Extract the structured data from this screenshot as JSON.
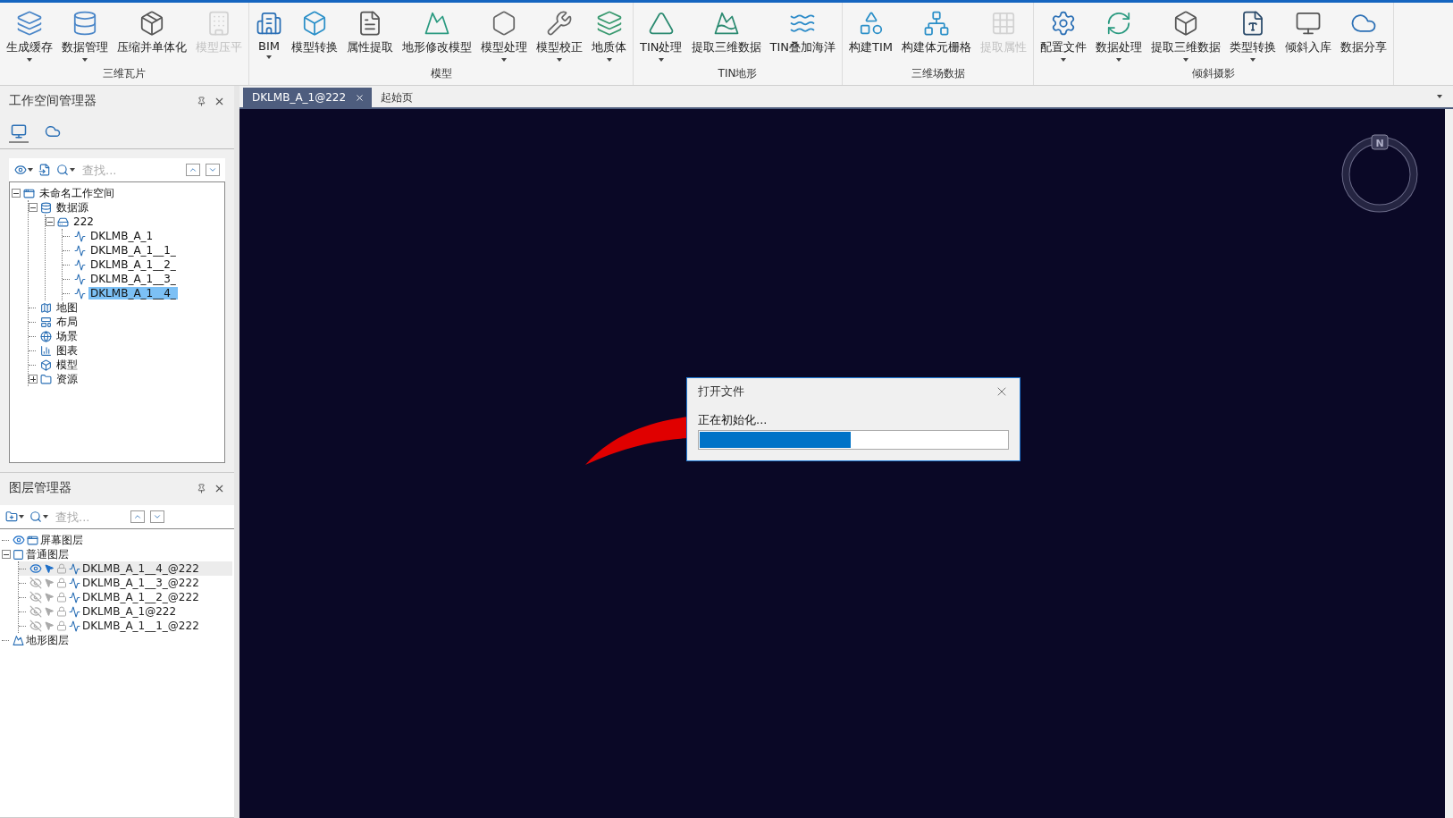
{
  "ribbon": {
    "groups": [
      {
        "label": "三维瓦片",
        "buttons": [
          {
            "label": "生成缓存",
            "menu": true,
            "disabled": false
          },
          {
            "label": "数据管理",
            "menu": true,
            "disabled": false
          },
          {
            "label": "压缩并单体化",
            "menu": false,
            "disabled": false
          },
          {
            "label": "模型压平",
            "menu": false,
            "disabled": true
          }
        ]
      },
      {
        "label": "模型",
        "buttons": [
          {
            "label": "BIM",
            "menu": true,
            "disabled": false
          },
          {
            "label": "模型转换",
            "menu": false,
            "disabled": false
          },
          {
            "label": "属性提取",
            "menu": false,
            "disabled": false
          },
          {
            "label": "地形修改模型",
            "menu": false,
            "disabled": false
          },
          {
            "label": "模型处理",
            "menu": true,
            "disabled": false
          },
          {
            "label": "模型校正",
            "menu": true,
            "disabled": false
          },
          {
            "label": "地质体",
            "menu": true,
            "disabled": false
          }
        ]
      },
      {
        "label": "TIN地形",
        "buttons": [
          {
            "label": "TIN处理",
            "menu": true,
            "disabled": false
          },
          {
            "label": "提取三维数据",
            "menu": false,
            "disabled": false
          },
          {
            "label": "TIN叠加海洋",
            "menu": false,
            "disabled": false
          }
        ]
      },
      {
        "label": "三维场数据",
        "buttons": [
          {
            "label": "构建TIM",
            "menu": false,
            "disabled": false
          },
          {
            "label": "构建体元栅格",
            "menu": false,
            "disabled": false
          },
          {
            "label": "提取属性",
            "menu": false,
            "disabled": true
          }
        ]
      },
      {
        "label": "倾斜摄影",
        "buttons": [
          {
            "label": "配置文件",
            "menu": true,
            "disabled": false
          },
          {
            "label": "数据处理",
            "menu": true,
            "disabled": false
          },
          {
            "label": "提取三维数据",
            "menu": true,
            "disabled": false
          },
          {
            "label": "类型转换",
            "menu": true,
            "disabled": false
          },
          {
            "label": "倾斜入库",
            "menu": false,
            "disabled": false
          },
          {
            "label": "数据分享",
            "menu": false,
            "disabled": false
          }
        ]
      }
    ]
  },
  "workspace_panel": {
    "title": "工作空间管理器",
    "tabs": [
      {
        "selected": true
      },
      {
        "selected": false
      }
    ],
    "search": {
      "placeholder": "查找..."
    },
    "tree": [
      {
        "label": "未命名工作空间",
        "kind": "workspace",
        "expanded": true,
        "selected": false,
        "children": [
          {
            "label": "数据源",
            "kind": "datasources",
            "expanded": true,
            "selected": false,
            "children": [
              {
                "label": "222",
                "kind": "database",
                "expanded": true,
                "selected": false,
                "children": [
                  {
                    "label": "DKLMB_A_1",
                    "kind": "dataset",
                    "selected": false
                  },
                  {
                    "label": "DKLMB_A_1__1_",
                    "kind": "dataset",
                    "selected": false
                  },
                  {
                    "label": "DKLMB_A_1__2_",
                    "kind": "dataset",
                    "selected": false
                  },
                  {
                    "label": "DKLMB_A_1__3_",
                    "kind": "dataset",
                    "selected": false
                  },
                  {
                    "label": "DKLMB_A_1__4_",
                    "kind": "dataset",
                    "selected": true
                  }
                ]
              }
            ]
          },
          {
            "label": "地图",
            "kind": "map",
            "selected": false
          },
          {
            "label": "布局",
            "kind": "layout",
            "selected": false
          },
          {
            "label": "场景",
            "kind": "scene",
            "selected": false
          },
          {
            "label": "图表",
            "kind": "chart",
            "selected": false
          },
          {
            "label": "模型",
            "kind": "model",
            "selected": false
          },
          {
            "label": "资源",
            "kind": "resource",
            "expanded": false,
            "selected": false
          }
        ]
      }
    ]
  },
  "layer_panel": {
    "title": "图层管理器",
    "search": {
      "placeholder": "查找..."
    },
    "tree": [
      {
        "label": "屏幕图层",
        "kind": "screen",
        "visible": true,
        "selected": false
      },
      {
        "label": "普通图层",
        "kind": "group",
        "expanded": true,
        "selected": false,
        "children": [
          {
            "label": "DKLMB_A_1__4_@222",
            "kind": "layer",
            "visible": true,
            "selectable": true,
            "selected": true
          },
          {
            "label": "DKLMB_A_1__3_@222",
            "kind": "layer",
            "visible": false,
            "selectable": false,
            "selected": false
          },
          {
            "label": "DKLMB_A_1__2_@222",
            "kind": "layer",
            "visible": false,
            "selectable": false,
            "selected": false
          },
          {
            "label": "DKLMB_A_1@222",
            "kind": "layer",
            "visible": false,
            "selectable": false,
            "selected": false
          },
          {
            "label": "DKLMB_A_1__1_@222",
            "kind": "layer",
            "visible": false,
            "selectable": false,
            "selected": false
          }
        ]
      },
      {
        "label": "地形图层",
        "kind": "terrain",
        "selected": false
      }
    ]
  },
  "document_tabs": [
    {
      "label": "DKLMB_A_1@222",
      "selected": true
    },
    {
      "label": "起始页",
      "selected": false
    }
  ],
  "scene": {
    "compass": "N"
  },
  "dialog": {
    "title": "打开文件",
    "message": "正在初始化...",
    "level": 0.49
  }
}
